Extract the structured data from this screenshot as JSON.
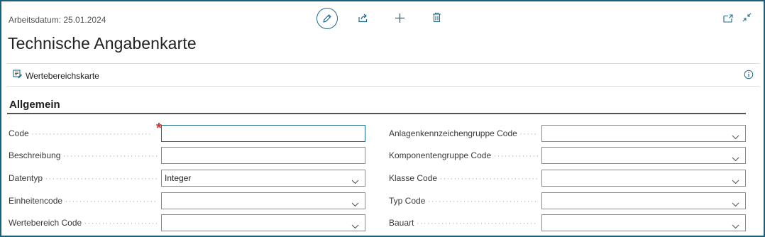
{
  "header": {
    "work_date": "Arbeitsdatum: 25.01.2024",
    "title": "Technische Angabenkarte"
  },
  "toolbar": {
    "edit_icon": "pencil-icon",
    "share_icon": "share-icon",
    "new_icon": "plus-icon",
    "delete_icon": "trash-icon",
    "open_new_window_icon": "open-in-new-window-icon",
    "collapse_icon": "collapse-icon"
  },
  "actions": {
    "value_range_card_label": "Wertebereichskarte"
  },
  "section": {
    "title": "Allgemein"
  },
  "fields_left": [
    {
      "label": "Code",
      "value": "",
      "required": true,
      "type": "text"
    },
    {
      "label": "Beschreibung",
      "value": "",
      "type": "text"
    },
    {
      "label": "Datentyp",
      "value": "Integer",
      "type": "select"
    },
    {
      "label": "Einheitencode",
      "value": "",
      "type": "select"
    },
    {
      "label": "Wertebereich Code",
      "value": "",
      "type": "select"
    }
  ],
  "fields_right": [
    {
      "label": "Anlagenkennzeichengruppe Code",
      "value": "",
      "type": "select"
    },
    {
      "label": "Komponentengruppe Code",
      "value": "",
      "type": "select"
    },
    {
      "label": "Klasse Code",
      "value": "",
      "type": "select"
    },
    {
      "label": "Typ Code",
      "value": "",
      "type": "select"
    },
    {
      "label": "Bauart",
      "value": "",
      "type": "select"
    }
  ],
  "colors": {
    "accent": "#1f6b8a",
    "required": "#d32f2f",
    "border": "#8a8a8a"
  }
}
